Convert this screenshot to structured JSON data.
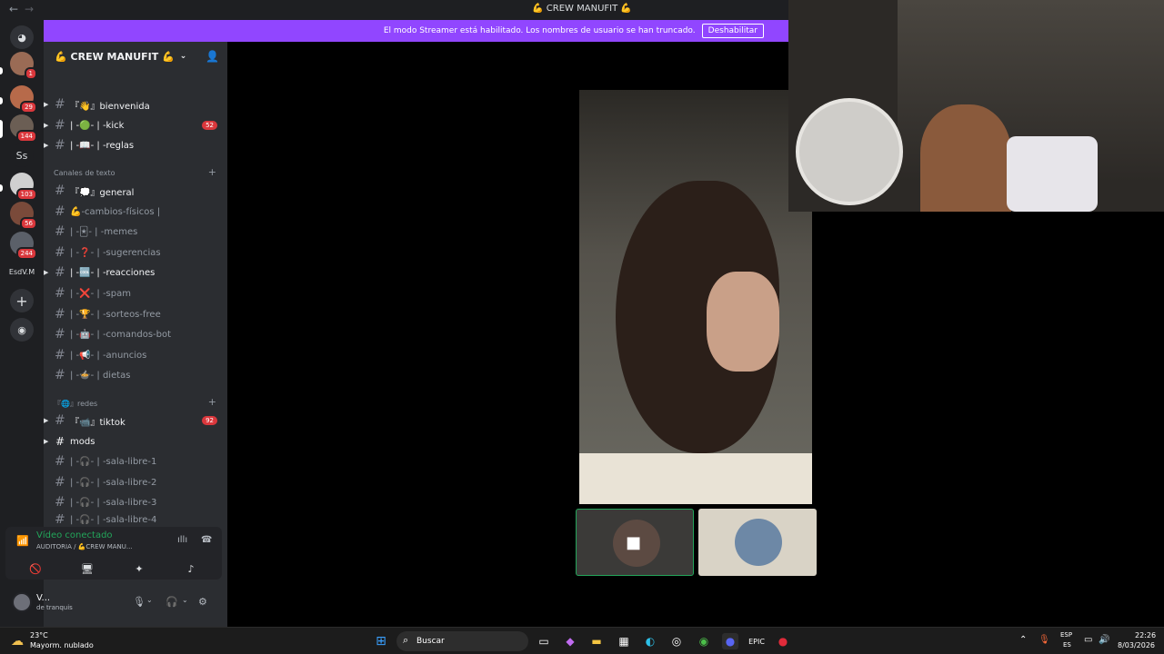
{
  "titlebar": {
    "back": "←",
    "forward": "→",
    "title": "💪 CREW MANUFIT 💪"
  },
  "streamer_bar": {
    "text": "El modo Streamer está habilitado. Los nombres de usuario se han truncado.",
    "button": "Deshabilitar"
  },
  "servers": [
    {
      "label": "",
      "badge": "1"
    },
    {
      "label": "",
      "badge": "29"
    },
    {
      "label": "",
      "badge": "144"
    },
    {
      "label": "Ss",
      "badge": ""
    },
    {
      "label": "",
      "badge": "103"
    },
    {
      "label": "",
      "badge": "56"
    },
    {
      "label": "",
      "badge": "244"
    },
    {
      "label": "EsdV.M",
      "badge": ""
    }
  ],
  "server": {
    "name": "💪 CREW MANUFIT 💪"
  },
  "channels_top": [
    {
      "label": "『👋』bienvenida",
      "badge": ""
    },
    {
      "label": "| -🟢- | -kick",
      "badge": "52"
    },
    {
      "label": "| -📖- | -reglas",
      "badge": ""
    }
  ],
  "category_text": "Canales de texto",
  "channels_text": [
    {
      "label": "『💭』general"
    },
    {
      "label": "💪-cambios-físicos |"
    },
    {
      "label": "| -🃏- | -memes"
    },
    {
      "label": "| -❓- | -sugerencias"
    },
    {
      "label": "| -🆒- | -reacciones"
    },
    {
      "label": "| -❌- | -spam"
    },
    {
      "label": "| -🏆- | -sorteos-free"
    },
    {
      "label": "| -🤖- | -comandos-bot"
    },
    {
      "label": "| -📢- | -anuncios"
    },
    {
      "label": "| -🍲- | dietas"
    }
  ],
  "category_redes": "『🌐』redes",
  "channels_redes": [
    {
      "label": "『📹』tiktok",
      "badge": "92"
    },
    {
      "label": "mods",
      "badge": ""
    },
    {
      "label": "| -🎧- | -sala-libre-1",
      "badge": ""
    },
    {
      "label": "| -🎧- | -sala-libre-2",
      "badge": ""
    },
    {
      "label": "| -🎧- | -sala-libre-3",
      "badge": ""
    },
    {
      "label": "| -🎧- | -sala-libre-4",
      "badge": ""
    }
  ],
  "voice": {
    "status": "Vídeo conectado",
    "location": "AUDITORIA / 💪CREW MANU..."
  },
  "user": {
    "name": "V...",
    "status": "de tranquis"
  },
  "taskbar": {
    "temp": "23°C",
    "weather": "Mayorm. nublado",
    "search_placeholder": "Buscar",
    "lang_top": "ESP",
    "lang_bottom": "ES",
    "time": "22:26",
    "date": "8/03/2026"
  }
}
